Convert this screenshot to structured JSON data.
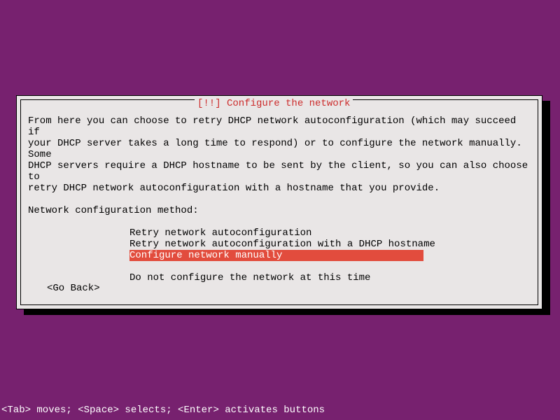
{
  "dialog": {
    "title": "[!!] Configure the network",
    "description": "From here you can choose to retry DHCP network autoconfiguration (which may succeed if\nyour DHCP server takes a long time to respond) or to configure the network manually. Some\nDHCP servers require a DHCP hostname to be sent by the client, so you can also choose to\nretry DHCP network autoconfiguration with a hostname that you provide.",
    "label": "Network configuration method:",
    "options": [
      "Retry network autoconfiguration",
      "Retry network autoconfiguration with a DHCP hostname",
      "Configure network manually",
      "Do not configure the network at this time"
    ],
    "selected_index": 2,
    "go_back": "<Go Back>"
  },
  "hint": "<Tab> moves; <Space> selects; <Enter> activates buttons"
}
